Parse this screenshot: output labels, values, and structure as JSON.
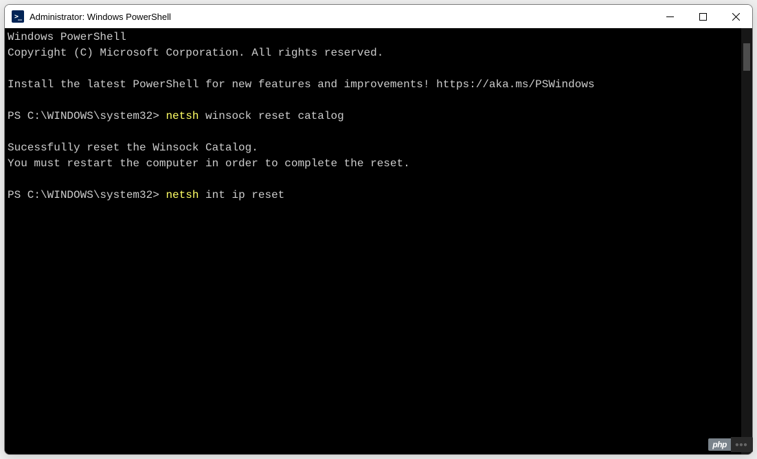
{
  "window": {
    "title": "Administrator: Windows PowerShell",
    "icon_label": "powershell-icon"
  },
  "terminal": {
    "header_line1": "Windows PowerShell",
    "header_line2": "Copyright (C) Microsoft Corporation. All rights reserved.",
    "install_line": "Install the latest PowerShell for new features and improvements! https://aka.ms/PSWindows",
    "prompt1": "PS C:\\WINDOWS\\system32> ",
    "cmd1_hilite": "netsh",
    "cmd1_rest": " winsock reset catalog",
    "result_line1": "Sucessfully reset the Winsock Catalog.",
    "result_line2": "You must restart the computer in order to complete the reset.",
    "prompt2": "PS C:\\WINDOWS\\system32> ",
    "cmd2_hilite": "netsh",
    "cmd2_rest": " int ip reset"
  },
  "watermark": {
    "badge": "php"
  }
}
